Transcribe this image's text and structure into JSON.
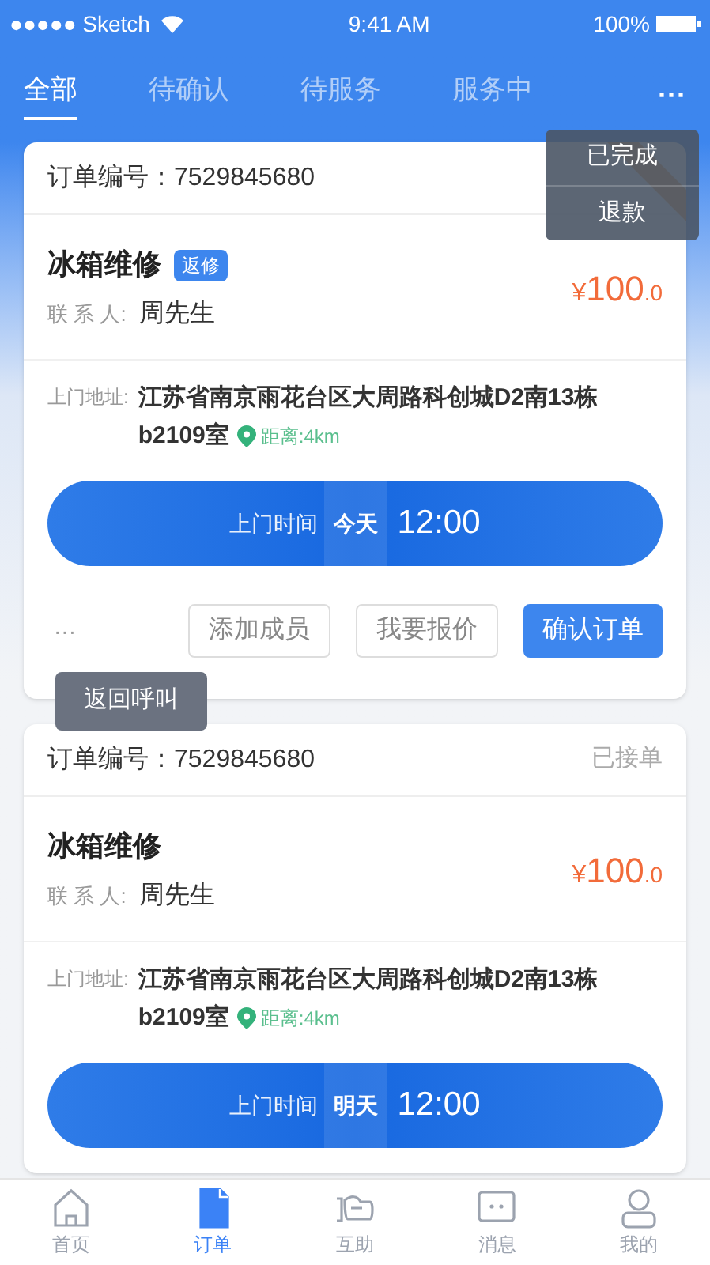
{
  "status_bar": {
    "carrier": "●●●●● Sketch",
    "time": "9:41 AM",
    "battery": "100%"
  },
  "tabs": [
    {
      "label": "全部",
      "selected": true
    },
    {
      "label": "待确认",
      "selected": false
    },
    {
      "label": "待服务",
      "selected": false
    },
    {
      "label": "服务中",
      "selected": false
    }
  ],
  "more_menu": {
    "button": "···",
    "items": [
      "已完成",
      "退款"
    ]
  },
  "orders": [
    {
      "number_label": "订单编号：",
      "number": "7529845680",
      "ribbon": true,
      "title": "冰箱维修",
      "tag": "返修",
      "contact_label": "联 系 人:",
      "contact": "周先生",
      "price_symbol": "¥",
      "price": "100",
      "price_decimal": ".0",
      "address_label": "上门地址:",
      "address_lines": [
        "江苏省南京雨花台区大周路科创城D2南13栋",
        "b2109室"
      ],
      "distance": "距离:4km",
      "time_label": "上门时间",
      "day": "今天",
      "time": "12:00",
      "more": "···",
      "tooltip": "返回呼叫",
      "actions": [
        {
          "label": "添加成员",
          "kind": "outline"
        },
        {
          "label": "我要报价",
          "kind": "outline"
        },
        {
          "label": "确认订单",
          "kind": "primary"
        }
      ]
    },
    {
      "number_label": "订单编号：",
      "number": "7529845680",
      "status": "已接单",
      "ribbon": false,
      "title": "冰箱维修",
      "contact_label": "联 系 人:",
      "contact": "周先生",
      "price_symbol": "¥",
      "price": "100",
      "price_decimal": ".0",
      "address_label": "上门地址:",
      "address_lines": [
        "江苏省南京雨花台区大周路科创城D2南13栋",
        "b2109室"
      ],
      "distance": "距离:4km",
      "time_label": "上门时间",
      "day": "明天",
      "time": "12:00"
    }
  ],
  "bottom_nav": [
    {
      "label": "首页",
      "kind": "home",
      "selected": false
    },
    {
      "label": "订单",
      "kind": "doc",
      "selected": true
    },
    {
      "label": "互助",
      "kind": "hand",
      "selected": false
    },
    {
      "label": "消息",
      "kind": "chat",
      "selected": false
    },
    {
      "label": "我的",
      "kind": "user",
      "selected": false
    }
  ]
}
